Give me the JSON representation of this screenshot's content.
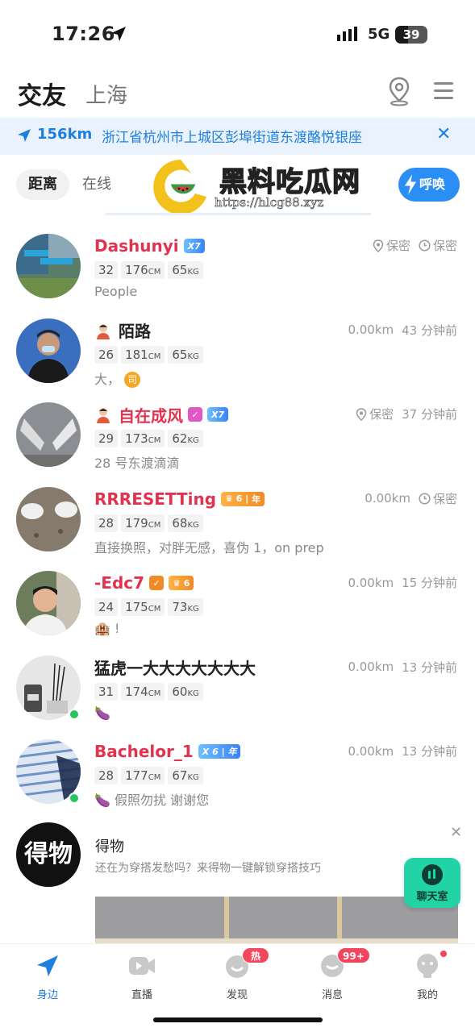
{
  "status_bar": {
    "time": "17:26",
    "network": "5G",
    "battery": "39",
    "battery_level": 0.39
  },
  "header": {
    "title": "交友",
    "city": "上海"
  },
  "banner": {
    "distance": "156km",
    "address": "浙江省杭州市上城区彭埠街道东渡酪悦银座",
    "close": "✕"
  },
  "tabs": [
    {
      "label": "距离"
    },
    {
      "label": "在线"
    }
  ],
  "call_button": {
    "label": "呼唤"
  },
  "watermark": {
    "title": "黑料吃瓜网",
    "url": "https://hlcg88.xyz"
  },
  "users": [
    {
      "name": "Dashunyi",
      "vip": "7",
      "right1": "保密",
      "right2": "保密",
      "age": "32",
      "height": "176",
      "weight": "65",
      "bio": "People"
    },
    {
      "name": "陌路",
      "right1": "0.00km",
      "right2": "43 分钟前",
      "age": "26",
      "height": "181",
      "weight": "65",
      "bio": "大，",
      "bio_tag": "司"
    },
    {
      "name": "自在成风",
      "vip": "7",
      "right1": "保密",
      "right2": "37 分钟前",
      "age": "29",
      "height": "173",
      "weight": "62",
      "bio": "28 号东渡滴滴"
    },
    {
      "name": "RRRESETTing",
      "gold": "6",
      "gold_suffix": "年",
      "right1": "0.00km",
      "right2": "保密",
      "age": "28",
      "height": "179",
      "weight": "68",
      "bio": "直接换照，对胖无感，喜伪 1，on prep"
    },
    {
      "name": "-Edc7",
      "gold": "6",
      "right1": "0.00km",
      "right2": "15 分钟前",
      "age": "24",
      "height": "175",
      "weight": "73",
      "bio": "🏨 !"
    },
    {
      "name": "猛虎一大大大大大大大",
      "right1": "0.00km",
      "right2": "13 分钟前",
      "age": "31",
      "height": "174",
      "weight": "60",
      "bio": "🍆"
    },
    {
      "name": "Bachelor_1",
      "vip": "6",
      "vip_suffix": "年",
      "right1": "0.00km",
      "right2": "13 分钟前",
      "age": "28",
      "height": "177",
      "weight": "67",
      "bio": "🍆 假照勿扰 谢谢您"
    }
  ],
  "units": {
    "height": "CM",
    "weight": "KG"
  },
  "ad": {
    "logo_text": "得物",
    "title": "得物",
    "desc": "还在为穿搭发愁吗？来得物一键解锁穿搭技巧",
    "close": "✕"
  },
  "chatroom": {
    "label": "聊天室"
  },
  "nav": [
    {
      "label": "身边"
    },
    {
      "label": "直播"
    },
    {
      "label": "发现",
      "badge": "热门"
    },
    {
      "label": "消息",
      "badge": "99+"
    },
    {
      "label": "我的"
    }
  ],
  "colors": {
    "accent": "#1d7fe0",
    "name_red": "#e0334f",
    "online": "#27c55a"
  }
}
